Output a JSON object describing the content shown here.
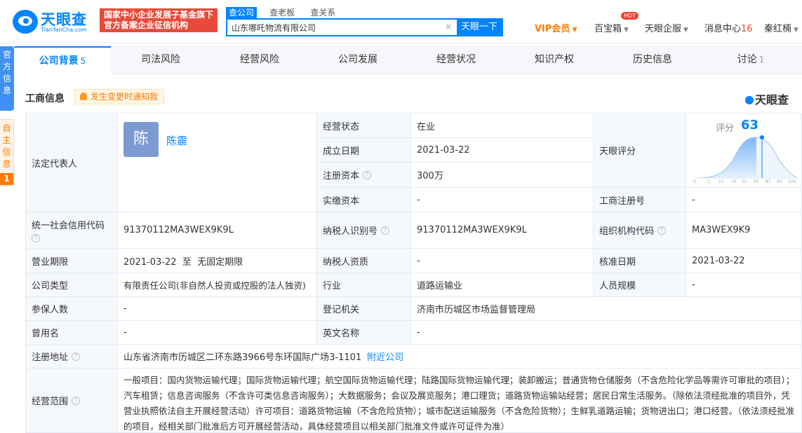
{
  "header": {
    "logo_text": "天眼查",
    "logo_sub": "TianYanCha.com",
    "badge_line1": "国家中小企业发展子基金旗下",
    "badge_line2": "官方备案企业征信机构",
    "search_tabs": [
      "查公司",
      "查老板",
      "查关系"
    ],
    "search_value": "山东哪吒物流有限公司",
    "search_clear": "×",
    "search_button": "天眼一下",
    "vip": "VIP会员",
    "baibaoxiang": "百宝箱",
    "hot": "HOT",
    "qiye": "天眼企服",
    "message_center": "消息中心",
    "message_count": "16",
    "username": "秦红楠"
  },
  "left_tags": {
    "tag1": "官方信息",
    "tag2": "自主信息",
    "tag2_count": "1"
  },
  "tabs": [
    {
      "label": "公司背景",
      "count": "5"
    },
    {
      "label": "司法风险",
      "count": ""
    },
    {
      "label": "经营风险",
      "count": ""
    },
    {
      "label": "公司发展",
      "count": ""
    },
    {
      "label": "经营状况",
      "count": ""
    },
    {
      "label": "知识产权",
      "count": ""
    },
    {
      "label": "历史信息",
      "count": ""
    },
    {
      "label": "讨论",
      "count": "1"
    }
  ],
  "section": {
    "title": "工商信息",
    "notify": "发生变更时通知我",
    "brand": "天眼查"
  },
  "info": {
    "legal_rep_label": "法定代表人",
    "legal_rep_avatar": "陈",
    "legal_rep_name": "陈震",
    "status_label": "经营状态",
    "status_value": "在业",
    "established_label": "成立日期",
    "established_value": "2021-03-22",
    "reg_capital_label": "注册资本",
    "reg_capital_value": "300万",
    "paid_capital_label": "实缴资本",
    "paid_capital_value": "-",
    "score_label": "天眼评分",
    "score_title": "评分",
    "score_value": "63",
    "score_axis": [
      "0",
      "1",
      "15",
      "35",
      "50",
      "65",
      "87",
      "95",
      "100"
    ],
    "biz_reg_no_label": "工商注册号",
    "biz_reg_no_value": "-",
    "credit_code_label": "统一社会信用代码",
    "credit_code_value": "91370112MA3WEX9K9L",
    "taxpayer_id_label": "纳税人识别号",
    "taxpayer_id_value": "91370112MA3WEX9K9L",
    "org_code_label": "组织机构代码",
    "org_code_value": "MA3WEX9K9",
    "term_label": "营业期限",
    "term_value": "2021-03-22  至  无固定期限",
    "taxpayer_qual_label": "纳税人资质",
    "taxpayer_qual_value": "-",
    "approval_date_label": "核准日期",
    "approval_date_value": "2021-03-22",
    "company_type_label": "公司类型",
    "company_type_value": "有限责任公司(非自然人投资或控股的法人独资)",
    "industry_label": "行业",
    "industry_value": "道路运输业",
    "staff_size_label": "人员规模",
    "staff_size_value": "-",
    "insured_label": "参保人数",
    "insured_value": "-",
    "authority_label": "登记机关",
    "authority_value": "济南市历城区市场监督管理局",
    "former_name_label": "曾用名",
    "former_name_value": "-",
    "english_name_label": "英文名称",
    "english_name_value": "-",
    "address_label": "注册地址",
    "address_value": "山东省济南市历城区二环东路3966号东环国际广场3-1101",
    "nearby_link": "附近公司",
    "scope_label": "经营范围",
    "scope_value": "一般项目：国内货物运输代理；国际货物运输代理；航空国际货物运输代理；陆路国际货物运输代理；装卸搬运；普通货物仓储服务（不含危险化学品等需许可审批的项目）；汽车租赁；信息咨询服务（不含许可类信息咨询服务）；大数据服务；会议及展览服务；港口理货；道路货物运输站经营；居民日常生活服务。（除依法须经批准的项目外，凭营业执照依法自主开展经营活动）许可项目：道路货物运输（不含危险货物）；城市配送运输服务（不含危险货物）；生鲜乳道路运输；货物进出口；港口经营。（依法须经批准的项目，经相关部门批准后方可开展经营活动，具体经营项目以相关部门批准文件或许可证件为准）"
  },
  "colors": {
    "accent": "#0084ff",
    "badge_red": "#e84a3a",
    "vip_orange": "#ff7a00",
    "label_bg": "#f5f8fd"
  }
}
